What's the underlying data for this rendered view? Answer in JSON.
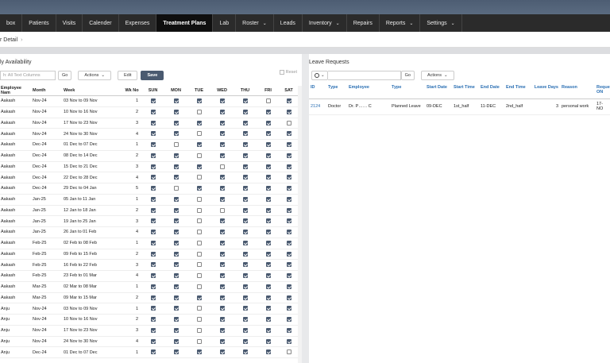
{
  "nav": {
    "items": [
      {
        "label": "box",
        "chev": false
      },
      {
        "label": "Patients",
        "chev": false
      },
      {
        "label": "Visits",
        "chev": false
      },
      {
        "label": "Calender",
        "chev": false
      },
      {
        "label": "Expenses",
        "chev": false
      },
      {
        "label": "Treatment Plans",
        "chev": false,
        "active": true
      },
      {
        "label": "Lab",
        "chev": false
      },
      {
        "label": "Roster",
        "chev": true
      },
      {
        "label": "Leads",
        "chev": false
      },
      {
        "label": "Inventory",
        "chev": true
      },
      {
        "label": "Repairs",
        "chev": false
      },
      {
        "label": "Reports",
        "chev": true
      },
      {
        "label": "Settings",
        "chev": true
      }
    ]
  },
  "breadcrumb": {
    "label": "r Detail",
    "sep": "›"
  },
  "availability": {
    "title": "ly Availability",
    "search_placeholder": "h: All Text Columns",
    "go": "Go",
    "actions": "Actions",
    "edit": "Edit",
    "save": "Save",
    "reset": "Reset",
    "headers": [
      "Employee Nam",
      "Month",
      "Week",
      "Wk No",
      "SUN",
      "MON",
      "TUE",
      "WED",
      "THU",
      "FRI",
      "SAT"
    ],
    "rows": [
      [
        "Aakash",
        "Nov-24",
        "03 Nov to 09 Nov",
        "1",
        1,
        1,
        1,
        1,
        1,
        0,
        1
      ],
      [
        "Aakash",
        "Nov-24",
        "10 Nov to 16 Nov",
        "2",
        1,
        1,
        0,
        1,
        1,
        1,
        1
      ],
      [
        "Aakash",
        "Nov-24",
        "17 Nov to 23 Nov",
        "3",
        1,
        1,
        1,
        1,
        1,
        1,
        0
      ],
      [
        "Aakash",
        "Nov-24",
        "24 Nov to 30 Nov",
        "4",
        1,
        1,
        0,
        1,
        1,
        1,
        1
      ],
      [
        "Aakash",
        "Dec-24",
        "01 Dec to 07 Dec",
        "1",
        1,
        0,
        1,
        1,
        1,
        1,
        1
      ],
      [
        "Aakash",
        "Dec-24",
        "08 Dec to 14 Dec",
        "2",
        1,
        1,
        0,
        1,
        1,
        1,
        1
      ],
      [
        "Aakash",
        "Dec-24",
        "15 Dec to 21 Dec",
        "3",
        1,
        1,
        1,
        0,
        1,
        1,
        1
      ],
      [
        "Aakash",
        "Dec-24",
        "22 Dec to 28 Dec",
        "4",
        1,
        1,
        0,
        1,
        1,
        1,
        1
      ],
      [
        "Aakash",
        "Dec-24",
        "29 Dec to 04 Jan",
        "5",
        1,
        0,
        1,
        1,
        1,
        1,
        1
      ],
      [
        "Aakash",
        "Jan-25",
        "05 Jan to 11 Jan",
        "1",
        1,
        1,
        0,
        1,
        1,
        1,
        1
      ],
      [
        "Aakash",
        "Jan-25",
        "12 Jan to 18 Jan",
        "2",
        1,
        1,
        0,
        0,
        1,
        1,
        1
      ],
      [
        "Aakash",
        "Jan-25",
        "19 Jan to 25 Jan",
        "3",
        1,
        1,
        0,
        1,
        1,
        1,
        1
      ],
      [
        "Aakash",
        "Jan-25",
        "26 Jan to 01 Feb",
        "4",
        1,
        1,
        0,
        1,
        1,
        1,
        1
      ],
      [
        "Aakash",
        "Feb-25",
        "02 Feb to 08 Feb",
        "1",
        1,
        1,
        0,
        1,
        1,
        1,
        1
      ],
      [
        "Aakash",
        "Feb-25",
        "09 Feb to 15 Feb",
        "2",
        1,
        1,
        0,
        1,
        1,
        1,
        1
      ],
      [
        "Aakash",
        "Feb-25",
        "16 Feb to 22 Feb",
        "3",
        1,
        1,
        0,
        1,
        1,
        1,
        1
      ],
      [
        "Aakash",
        "Feb-25",
        "23 Feb to 01 Mar",
        "4",
        1,
        1,
        0,
        1,
        1,
        1,
        1
      ],
      [
        "Aakash",
        "Mar-25",
        "02 Mar to 08 Mar",
        "1",
        1,
        1,
        0,
        1,
        1,
        1,
        1
      ],
      [
        "Aakash",
        "Mar-25",
        "09 Mar to 15 Mar",
        "2",
        1,
        1,
        1,
        1,
        1,
        1,
        1
      ],
      [
        "Anju",
        "Nov-24",
        "03 Nov to 09 Nov",
        "1",
        1,
        1,
        0,
        1,
        1,
        1,
        1
      ],
      [
        "Anju",
        "Nov-24",
        "10 Nov to 16 Nov",
        "2",
        1,
        1,
        0,
        1,
        1,
        1,
        1
      ],
      [
        "Anju",
        "Nov-24",
        "17 Nov to 23 Nov",
        "3",
        1,
        1,
        0,
        1,
        1,
        1,
        1
      ],
      [
        "Anju",
        "Nov-24",
        "24 Nov to 30 Nov",
        "4",
        1,
        1,
        0,
        1,
        1,
        1,
        1
      ],
      [
        "Anju",
        "Dec-24",
        "01 Dec to 07 Dec",
        "1",
        1,
        1,
        1,
        1,
        1,
        1,
        0
      ]
    ]
  },
  "leave": {
    "title": "Leave Requests",
    "go": "Go",
    "actions": "Actions",
    "headers": [
      "ID",
      "Type",
      "Employee",
      "Type",
      "Start Date",
      "Start Time",
      "End Date",
      "End Time",
      "Leave Days",
      "Reason",
      "Reque ON"
    ],
    "rows": [
      [
        "2124",
        "Doctor",
        "Dr. P…… C",
        "Planned Leave",
        "09-DEC",
        "1st_half",
        "11-DEC",
        "2nd_half",
        "3",
        "personal work",
        "17-NO"
      ]
    ]
  }
}
